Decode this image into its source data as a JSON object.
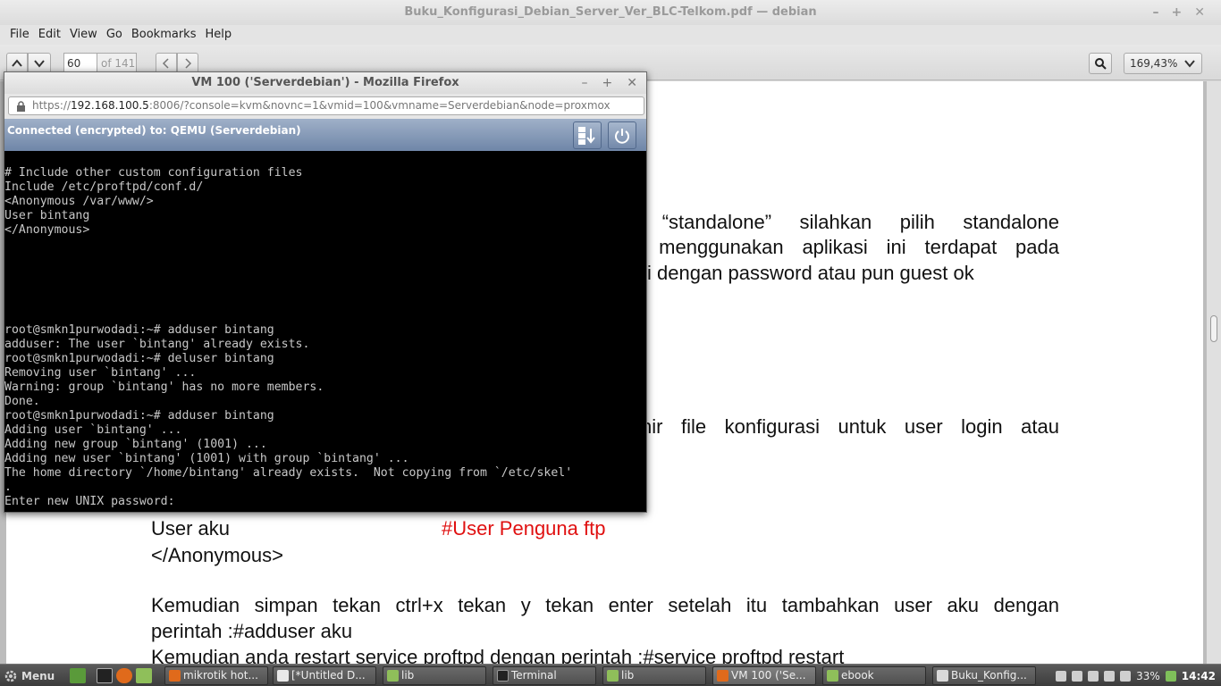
{
  "evince": {
    "title": "Buku_Konfigurasi_Debian_Server_Ver_BLC-Telkom.pdf — debian",
    "menu": [
      "File",
      "Edit",
      "View",
      "Go",
      "Bookmarks",
      "Help"
    ],
    "page_current": "60",
    "page_total": "of 141",
    "zoom": "169,43%"
  },
  "document": {
    "lines": [
      "n “standalone” silahkan pilih standalone",
      "r menggunakan aplikasi ini terdapat pada",
      "si dengan password atau pun guest ok",
      "hir file konfigurasi untuk user login atau",
      "perintah :#adduser aku",
      "Kemudian anda restart service proftpd dengan perintah :#service proftpd restart"
    ],
    "user_line": "User aku",
    "user_comment": "#User Penguna ftp",
    "anon_close": "</Anonymous>",
    "paragraph": "Kemudian simpan tekan ctrl+x tekan y tekan enter setelah itu tambahkan user aku dengan"
  },
  "firefox": {
    "title": "VM 100 ('Serverdebian') - Mozilla Firefox",
    "url_scheme": "https://",
    "url_host": "192.168.100.5",
    "url_rest": ":8006/?console=kvm&novnc=1&vmid=100&vmname=Serverdebian&node=proxmox",
    "novnc_status": "Connected (encrypted) to: QEMU (Serverdebian)"
  },
  "terminal": {
    "lines": [
      "# Include other custom configuration files",
      "Include /etc/proftpd/conf.d/",
      "<Anonymous /var/www/>",
      "User bintang",
      "</Anonymous>",
      "",
      "",
      "",
      "",
      "",
      "",
      "root@smkn1purwodadi:~# adduser bintang",
      "adduser: The user `bintang' already exists.",
      "root@smkn1purwodadi:~# deluser bintang",
      "Removing user `bintang' ...",
      "Warning: group `bintang' has no more members.",
      "Done.",
      "root@smkn1purwodadi:~# adduser bintang",
      "Adding user `bintang' ...",
      "Adding new group `bintang' (1001) ...",
      "Adding new user `bintang' (1001) with group `bintang' ...",
      "The home directory `/home/bintang' already exists.  Not copying from `/etc/skel'",
      ".",
      "Enter new UNIX password:"
    ]
  },
  "taskbar": {
    "menu_label": "Menu",
    "tasks": [
      {
        "label": "mikrotik hot...",
        "icon_color": "#e06a1b"
      },
      {
        "label": "[*Untitled D...",
        "icon_color": "#e8e8e8"
      },
      {
        "label": "lib",
        "icon_color": "#8fbf5a"
      },
      {
        "label": "Terminal",
        "icon_color": "#222222"
      },
      {
        "label": "lib",
        "icon_color": "#8fbf5a"
      },
      {
        "label": "VM 100 ('Se...",
        "icon_color": "#e06a1b"
      },
      {
        "label": "ebook",
        "icon_color": "#8fbf5a"
      },
      {
        "label": "Buku_Konfig...",
        "icon_color": "#d9d9d9"
      }
    ],
    "battery": "33%",
    "clock": "14:42"
  }
}
